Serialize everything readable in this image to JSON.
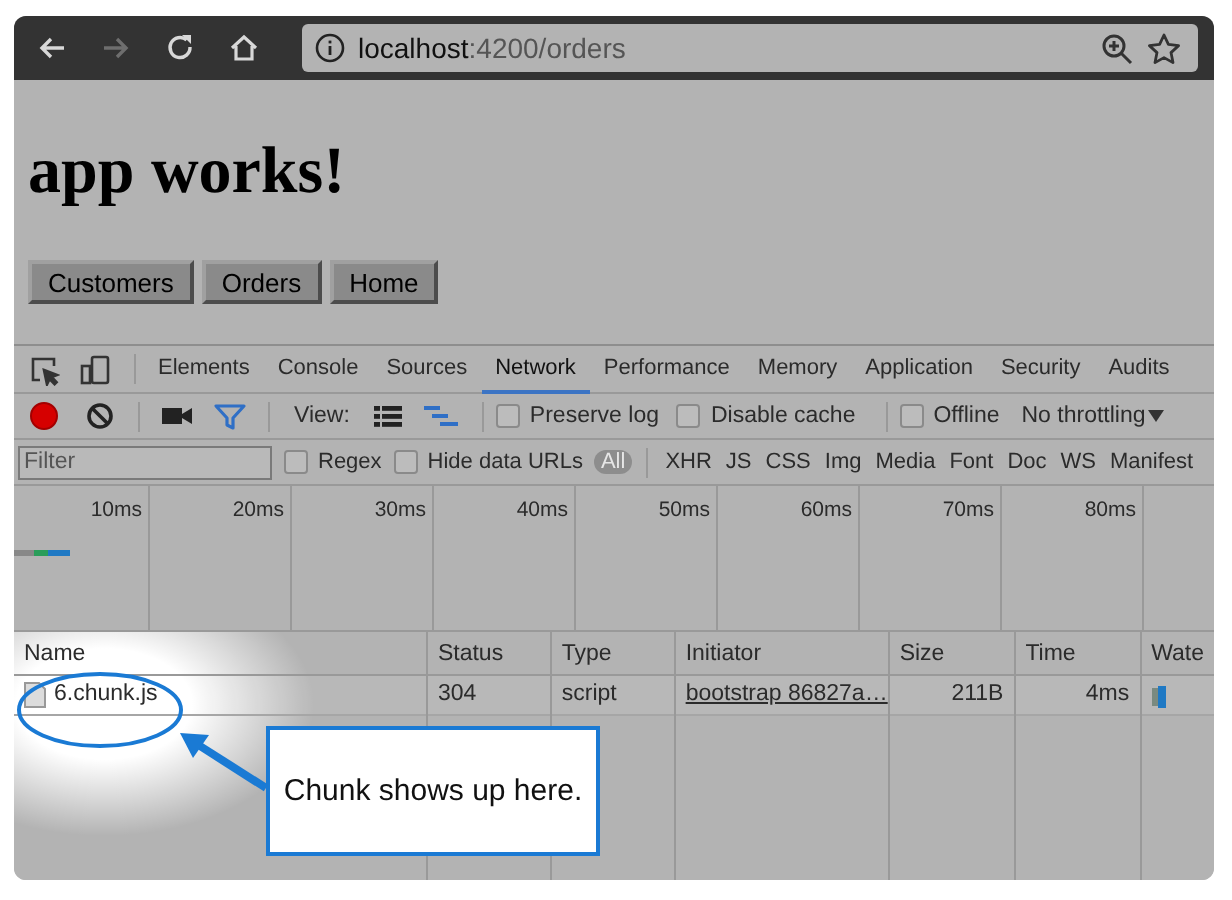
{
  "browser": {
    "nav": [
      {
        "kind": "back",
        "disabled": false
      },
      {
        "kind": "forward",
        "disabled": true
      },
      {
        "kind": "reload",
        "disabled": false
      },
      {
        "kind": "home",
        "disabled": false
      }
    ],
    "url_host": "localhost",
    "url_path": ":4200/orders"
  },
  "page": {
    "heading": "app works!",
    "buttons": [
      "Customers",
      "Orders",
      "Home"
    ]
  },
  "devtools": {
    "tabs": [
      {
        "label": "Elements",
        "selected": false
      },
      {
        "label": "Console",
        "selected": false
      },
      {
        "label": "Sources",
        "selected": false
      },
      {
        "label": "Network",
        "selected": true
      },
      {
        "label": "Performance",
        "selected": false
      },
      {
        "label": "Memory",
        "selected": false
      },
      {
        "label": "Application",
        "selected": false
      },
      {
        "label": "Security",
        "selected": false
      },
      {
        "label": "Audits",
        "selected": false
      }
    ],
    "toolbar": {
      "recording": true,
      "view_label": "View:",
      "checkboxes": [
        {
          "label": "Preserve log",
          "checked": false
        },
        {
          "label": "Disable cache",
          "checked": false
        }
      ],
      "offline": {
        "label": "Offline",
        "checked": false
      },
      "throttling": "No throttling"
    },
    "filter": {
      "placeholder": "Filter",
      "options": [
        {
          "label": "Regex",
          "checked": false
        },
        {
          "label": "Hide data URLs",
          "checked": false
        }
      ],
      "types": [
        {
          "label": "All",
          "selected": true
        },
        {
          "label": "XHR",
          "selected": false
        },
        {
          "label": "JS",
          "selected": false
        },
        {
          "label": "CSS",
          "selected": false
        },
        {
          "label": "Img",
          "selected": false
        },
        {
          "label": "Media",
          "selected": false
        },
        {
          "label": "Font",
          "selected": false
        },
        {
          "label": "Doc",
          "selected": false
        },
        {
          "label": "WS",
          "selected": false
        },
        {
          "label": "Manifest",
          "selected": false
        }
      ]
    },
    "timeline": {
      "ticks": [
        "10ms",
        "20ms",
        "30ms",
        "40ms",
        "50ms",
        "60ms",
        "70ms",
        "80ms"
      ]
    },
    "table": {
      "columns": [
        "Name",
        "Status",
        "Type",
        "Initiator",
        "Size",
        "Time",
        "Wate"
      ],
      "rows": [
        {
          "name": "6.chunk.js",
          "status": "304",
          "type": "script",
          "initiator": "bootstrap 86827a…",
          "size": "211B",
          "time": "4ms"
        }
      ]
    }
  },
  "annotation": {
    "text": "Chunk shows up here."
  }
}
